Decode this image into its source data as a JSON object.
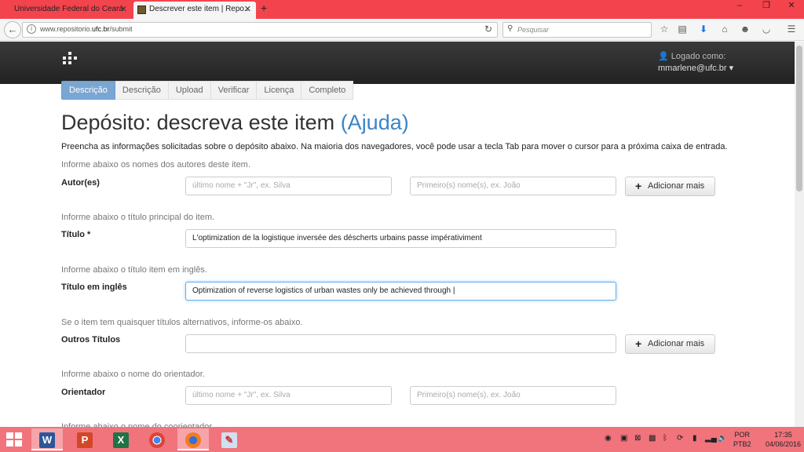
{
  "browser": {
    "tabs": [
      {
        "title": "Universidade Federal do Ceará"
      },
      {
        "title": "Descrever este item | Repo..."
      }
    ],
    "url_prefix": "www.repositorio.",
    "url_domain": "ufc.br",
    "url_suffix": "/submit",
    "search_placeholder": "Pesquisar"
  },
  "header": {
    "logged_label": "Logado como:",
    "user_email": "mmarlene@ufc.br"
  },
  "steps": [
    "Descrição",
    "Descrição",
    "Upload",
    "Verificar",
    "Licença",
    "Completo"
  ],
  "page": {
    "title": "Depósito: descreva este item",
    "help_link": "(Ajuda)",
    "intro": "Preencha as informações solicitadas sobre o depósito abaixo. Na maioria dos navegadores, você pode usar a tecla Tab para mover o cursor para a próxima caixa de entrada."
  },
  "fields": {
    "authors": {
      "hint": "Informe abaixo os nomes dos autores deste item.",
      "label": "Autor(es)",
      "last_placeholder": "último nome + \"Jr\", ex. Silva",
      "first_placeholder": "Primeiro(s) nome(s),  ex. João",
      "add_label": "Adicionar mais"
    },
    "title": {
      "hint": "Informe abaixo o título principal do item.",
      "label": "Título *",
      "value": "L'optimization de la logistique inversée des déscherts urbains passe impérativiment"
    },
    "title_en": {
      "hint": "Informe abaixo o título item em inglês.",
      "label": "Título em inglês",
      "value": "Optimization of reverse logistics of urban wastes only be achieved through |"
    },
    "other_titles": {
      "hint": "Se o item tem quaisquer títulos alternativos, informe-os abaixo.",
      "label": "Outros Títulos",
      "value": "",
      "add_label": "Adicionar mais"
    },
    "advisor": {
      "hint": "Informe abaixo o nome do orientador.",
      "label": "Orientador",
      "last_placeholder": "último nome + \"Jr\", ex. Silva",
      "first_placeholder": "Primeiro(s) nome(s),  ex. João"
    },
    "coadvisor": {
      "hint": "Informe abaixo o nome do coorientador."
    }
  },
  "taskbar": {
    "apps": [
      "word-icon",
      "powerpoint-icon",
      "excel-icon",
      "chrome-icon",
      "firefox-icon",
      "paint-icon"
    ],
    "lang_top": "POR",
    "lang_bottom": "PTB2",
    "time": "17:35",
    "date": "04/06/2016"
  },
  "colors": {
    "tabbar": "#f3444e",
    "taskbar": "#f1737c",
    "active_step": "#7aa6d3",
    "link": "#3c85c6"
  }
}
